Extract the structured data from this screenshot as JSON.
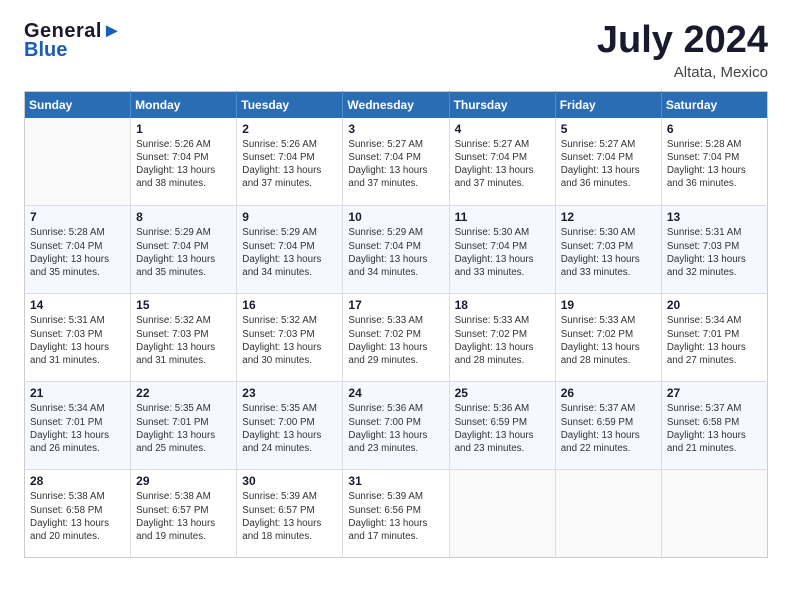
{
  "header": {
    "logo_line1": "General",
    "logo_line2": "Blue",
    "title": "July 2024",
    "location": "Altata, Mexico"
  },
  "days_of_week": [
    "Sunday",
    "Monday",
    "Tuesday",
    "Wednesday",
    "Thursday",
    "Friday",
    "Saturday"
  ],
  "weeks": [
    {
      "days": [
        {
          "num": "",
          "info": ""
        },
        {
          "num": "1",
          "info": "Sunrise: 5:26 AM\nSunset: 7:04 PM\nDaylight: 13 hours\nand 38 minutes."
        },
        {
          "num": "2",
          "info": "Sunrise: 5:26 AM\nSunset: 7:04 PM\nDaylight: 13 hours\nand 37 minutes."
        },
        {
          "num": "3",
          "info": "Sunrise: 5:27 AM\nSunset: 7:04 PM\nDaylight: 13 hours\nand 37 minutes."
        },
        {
          "num": "4",
          "info": "Sunrise: 5:27 AM\nSunset: 7:04 PM\nDaylight: 13 hours\nand 37 minutes."
        },
        {
          "num": "5",
          "info": "Sunrise: 5:27 AM\nSunset: 7:04 PM\nDaylight: 13 hours\nand 36 minutes."
        },
        {
          "num": "6",
          "info": "Sunrise: 5:28 AM\nSunset: 7:04 PM\nDaylight: 13 hours\nand 36 minutes."
        }
      ]
    },
    {
      "days": [
        {
          "num": "7",
          "info": "Sunrise: 5:28 AM\nSunset: 7:04 PM\nDaylight: 13 hours\nand 35 minutes."
        },
        {
          "num": "8",
          "info": "Sunrise: 5:29 AM\nSunset: 7:04 PM\nDaylight: 13 hours\nand 35 minutes."
        },
        {
          "num": "9",
          "info": "Sunrise: 5:29 AM\nSunset: 7:04 PM\nDaylight: 13 hours\nand 34 minutes."
        },
        {
          "num": "10",
          "info": "Sunrise: 5:29 AM\nSunset: 7:04 PM\nDaylight: 13 hours\nand 34 minutes."
        },
        {
          "num": "11",
          "info": "Sunrise: 5:30 AM\nSunset: 7:04 PM\nDaylight: 13 hours\nand 33 minutes."
        },
        {
          "num": "12",
          "info": "Sunrise: 5:30 AM\nSunset: 7:03 PM\nDaylight: 13 hours\nand 33 minutes."
        },
        {
          "num": "13",
          "info": "Sunrise: 5:31 AM\nSunset: 7:03 PM\nDaylight: 13 hours\nand 32 minutes."
        }
      ]
    },
    {
      "days": [
        {
          "num": "14",
          "info": "Sunrise: 5:31 AM\nSunset: 7:03 PM\nDaylight: 13 hours\nand 31 minutes."
        },
        {
          "num": "15",
          "info": "Sunrise: 5:32 AM\nSunset: 7:03 PM\nDaylight: 13 hours\nand 31 minutes."
        },
        {
          "num": "16",
          "info": "Sunrise: 5:32 AM\nSunset: 7:03 PM\nDaylight: 13 hours\nand 30 minutes."
        },
        {
          "num": "17",
          "info": "Sunrise: 5:33 AM\nSunset: 7:02 PM\nDaylight: 13 hours\nand 29 minutes."
        },
        {
          "num": "18",
          "info": "Sunrise: 5:33 AM\nSunset: 7:02 PM\nDaylight: 13 hours\nand 28 minutes."
        },
        {
          "num": "19",
          "info": "Sunrise: 5:33 AM\nSunset: 7:02 PM\nDaylight: 13 hours\nand 28 minutes."
        },
        {
          "num": "20",
          "info": "Sunrise: 5:34 AM\nSunset: 7:01 PM\nDaylight: 13 hours\nand 27 minutes."
        }
      ]
    },
    {
      "days": [
        {
          "num": "21",
          "info": "Sunrise: 5:34 AM\nSunset: 7:01 PM\nDaylight: 13 hours\nand 26 minutes."
        },
        {
          "num": "22",
          "info": "Sunrise: 5:35 AM\nSunset: 7:01 PM\nDaylight: 13 hours\nand 25 minutes."
        },
        {
          "num": "23",
          "info": "Sunrise: 5:35 AM\nSunset: 7:00 PM\nDaylight: 13 hours\nand 24 minutes."
        },
        {
          "num": "24",
          "info": "Sunrise: 5:36 AM\nSunset: 7:00 PM\nDaylight: 13 hours\nand 23 minutes."
        },
        {
          "num": "25",
          "info": "Sunrise: 5:36 AM\nSunset: 6:59 PM\nDaylight: 13 hours\nand 23 minutes."
        },
        {
          "num": "26",
          "info": "Sunrise: 5:37 AM\nSunset: 6:59 PM\nDaylight: 13 hours\nand 22 minutes."
        },
        {
          "num": "27",
          "info": "Sunrise: 5:37 AM\nSunset: 6:58 PM\nDaylight: 13 hours\nand 21 minutes."
        }
      ]
    },
    {
      "days": [
        {
          "num": "28",
          "info": "Sunrise: 5:38 AM\nSunset: 6:58 PM\nDaylight: 13 hours\nand 20 minutes."
        },
        {
          "num": "29",
          "info": "Sunrise: 5:38 AM\nSunset: 6:57 PM\nDaylight: 13 hours\nand 19 minutes."
        },
        {
          "num": "30",
          "info": "Sunrise: 5:39 AM\nSunset: 6:57 PM\nDaylight: 13 hours\nand 18 minutes."
        },
        {
          "num": "31",
          "info": "Sunrise: 5:39 AM\nSunset: 6:56 PM\nDaylight: 13 hours\nand 17 minutes."
        },
        {
          "num": "",
          "info": ""
        },
        {
          "num": "",
          "info": ""
        },
        {
          "num": "",
          "info": ""
        }
      ]
    }
  ]
}
